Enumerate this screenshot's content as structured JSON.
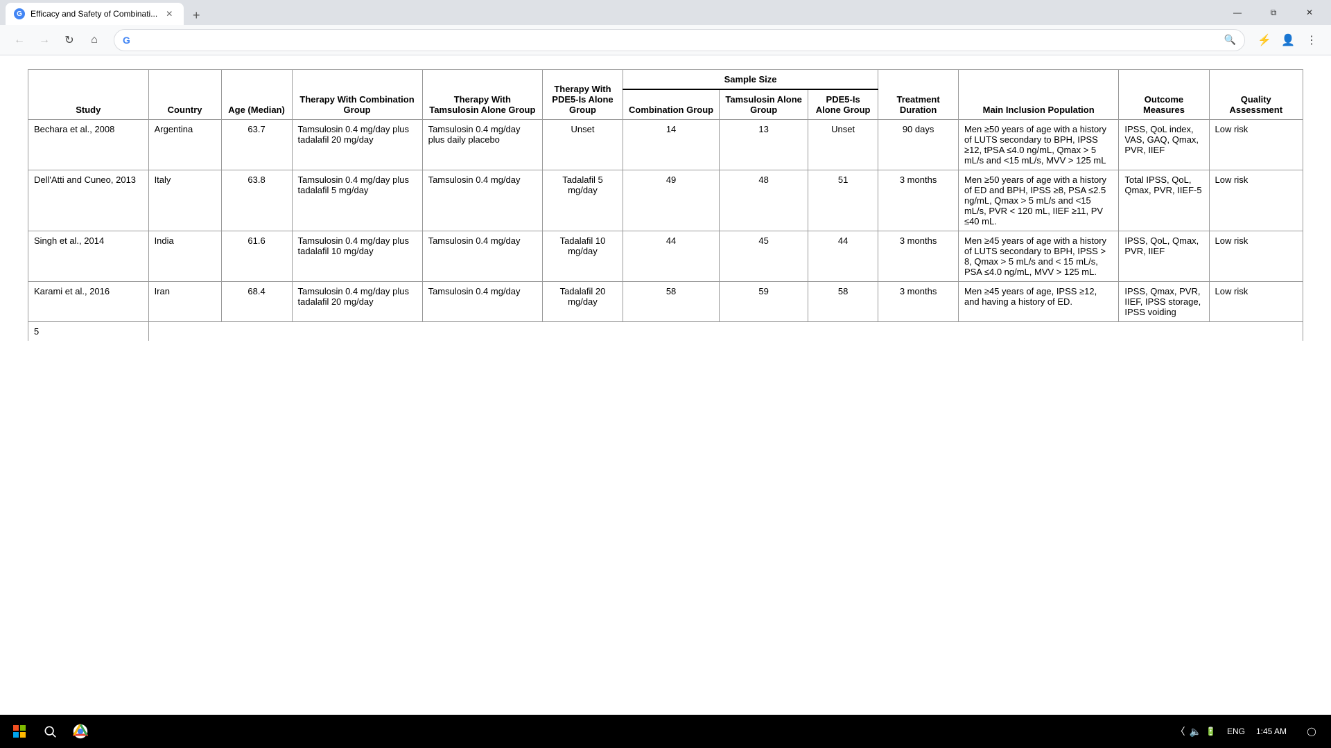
{
  "browser": {
    "tab_title": "Efficacy and Safety of Combinati...",
    "tab_favicon": "G",
    "address_bar_value": "G",
    "address_bar_placeholder": "",
    "window_buttons": {
      "minimize": "—",
      "maximize": "⧉",
      "close": "✕"
    }
  },
  "taskbar": {
    "time": "1:45 AM",
    "date": "ENG",
    "language": "ENG"
  },
  "table": {
    "headers": {
      "study": "Study",
      "country": "Country",
      "age_median": "Age (Median)",
      "therapy_combination": "Therapy With Combination Group",
      "therapy_tamsulosin": "Therapy With Tamsulosin Alone Group",
      "therapy_pde5": "Therapy With PDE5-Is Alone Group",
      "sample_size_label": "Sample Size",
      "combination_group": "Combination Group",
      "tamsulosin_alone": "Tamsulosin Alone Group",
      "pde5_alone": "PDE5-Is Alone Group",
      "treatment_duration": "Treatment Duration",
      "main_inclusion": "Main Inclusion Population",
      "outcome_measures": "Outcome Measures",
      "quality_assessment": "Quality Assessment"
    },
    "rows": [
      {
        "study": "Bechara et al., 2008",
        "country": "Argentina",
        "age": "63.7",
        "therapy_combo": "Tamsulosin 0.4 mg/day plus tadalafil 20 mg/day",
        "therapy_tams": "Tamsulosin 0.4 mg/day plus daily placebo",
        "therapy_pde5": "Unset",
        "combination": "14",
        "tamsulosin_alone": "13",
        "pde5_alone": "Unset",
        "treatment_duration": "90 days",
        "main_inclusion": "Men ≥50 years of age with a history of LUTS secondary to BPH, IPSS ≥12, tPSA ≤4.0 ng/mL, Qmax > 5 mL/s and <15 mL/s, MVV > 125 mL",
        "outcome_measures": "IPSS, QoL index, VAS, GAQ, Qmax, PVR, IIEF",
        "quality": "Low risk"
      },
      {
        "study": "Dell'Atti and Cuneo, 2013",
        "country": "Italy",
        "age": "63.8",
        "therapy_combo": "Tamsulosin 0.4 mg/day plus tadalafil 5 mg/day",
        "therapy_tams": "Tamsulosin 0.4 mg/day",
        "therapy_pde5": "Tadalafil 5 mg/day",
        "combination": "49",
        "tamsulosin_alone": "48",
        "pde5_alone": "51",
        "treatment_duration": "3 months",
        "main_inclusion": "Men ≥50 years of age with a history of ED and BPH, IPSS ≥8, PSA ≤2.5 ng/mL, Qmax > 5 mL/s and <15 mL/s, PVR < 120 mL, IIEF ≥11, PV ≤40 mL.",
        "outcome_measures": "Total IPSS, QoL, Qmax, PVR, IIEF-5",
        "quality": "Low risk"
      },
      {
        "study": "Singh et al., 2014",
        "country": "India",
        "age": "61.6",
        "therapy_combo": "Tamsulosin 0.4 mg/day plus tadalafil 10 mg/day",
        "therapy_tams": "Tamsulosin 0.4 mg/day",
        "therapy_pde5": "Tadalafil 10 mg/day",
        "combination": "44",
        "tamsulosin_alone": "45",
        "pde5_alone": "44",
        "treatment_duration": "3 months",
        "main_inclusion": "Men ≥45 years of age with a history of LUTS secondary to BPH, IPSS > 8, Qmax > 5 mL/s and < 15 mL/s, PSA ≤4.0 ng/mL, MVV > 125 mL.",
        "outcome_measures": "IPSS, QoL, Qmax, PVR, IIEF",
        "quality": "Low risk"
      },
      {
        "study": "Karami et al., 2016",
        "country": "Iran",
        "age": "68.4",
        "therapy_combo": "Tamsulosin 0.4 mg/day plus tadalafil 20 mg/day",
        "therapy_tams": "Tamsulosin 0.4 mg/day",
        "therapy_pde5": "Tadalafil 20 mg/day",
        "combination": "58",
        "tamsulosin_alone": "59",
        "pde5_alone": "58",
        "treatment_duration": "3 months",
        "main_inclusion": "Men ≥45 years of age, IPSS ≥12, and having a history of ED.",
        "outcome_measures": "IPSS, Qmax, PVR, IIEF, IPSS storage, IPSS voiding",
        "quality": "Low risk"
      }
    ]
  }
}
